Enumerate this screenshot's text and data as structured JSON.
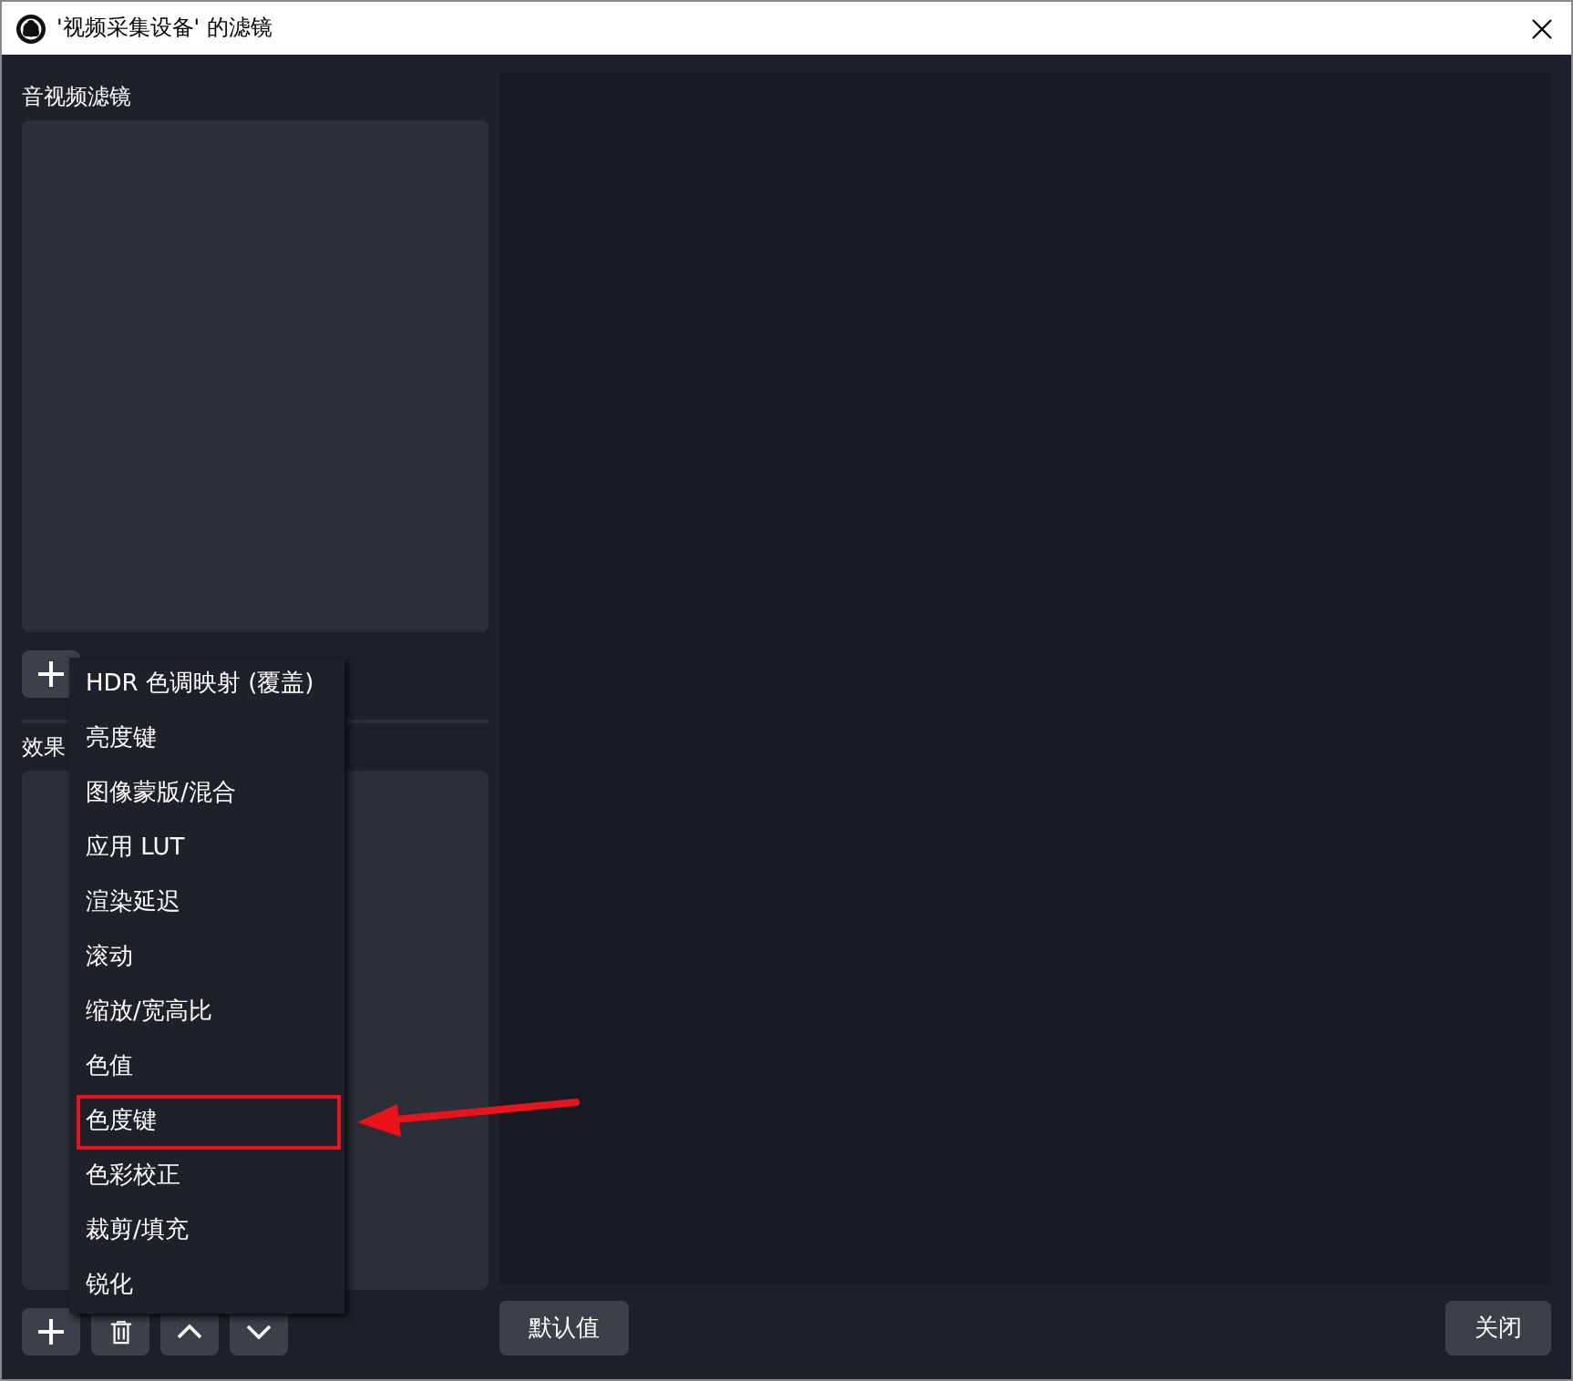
{
  "window": {
    "title": "'视频采集设备' 的滤镜"
  },
  "audio_video_filters": {
    "label": "音视频滤镜"
  },
  "effect_filters": {
    "label": "效果"
  },
  "add_menu": {
    "items": [
      {
        "label": "HDR 色调映射 (覆盖)",
        "selected": false
      },
      {
        "label": "亮度键",
        "selected": false
      },
      {
        "label": "图像蒙版/混合",
        "selected": false
      },
      {
        "label": "应用 LUT",
        "selected": false
      },
      {
        "label": "渲染延迟",
        "selected": false
      },
      {
        "label": "滚动",
        "selected": false
      },
      {
        "label": "缩放/宽高比",
        "selected": false
      },
      {
        "label": "色值",
        "selected": false
      },
      {
        "label": "色度键",
        "selected": true
      },
      {
        "label": "色彩校正",
        "selected": false
      },
      {
        "label": "裁剪/填充",
        "selected": false
      },
      {
        "label": "锐化",
        "selected": false
      }
    ]
  },
  "buttons": {
    "defaults": "默认值",
    "close": "关闭"
  }
}
